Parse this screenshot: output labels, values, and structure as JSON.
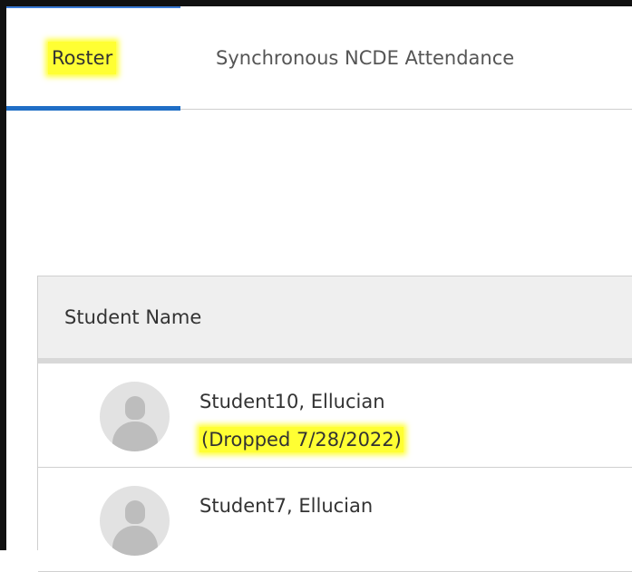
{
  "tabs": [
    {
      "label": "Roster",
      "active": true
    },
    {
      "label": "Synchronous NCDE Attendance",
      "active": false
    }
  ],
  "table": {
    "header": "Student Name",
    "rows": [
      {
        "name": "Student10, Ellucian",
        "status": "(Dropped 7/28/2022)"
      },
      {
        "name": "Student7, Ellucian",
        "status": ""
      }
    ]
  },
  "colors": {
    "highlight": "#ffff33",
    "active_tab_underline": "#1f6ec6"
  }
}
